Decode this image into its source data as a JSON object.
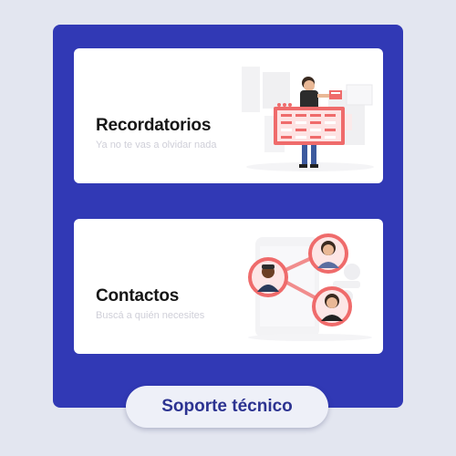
{
  "cards": [
    {
      "title": "Recordatorios",
      "subtitle": "Ya no te vas a olvidar nada",
      "icon": "calendar-reminder-illustration-icon"
    },
    {
      "title": "Contactos",
      "subtitle": "Buscá a quién necesites",
      "icon": "contacts-network-illustration-icon"
    }
  ],
  "support_button": {
    "label": "Soporte técnico"
  },
  "colors": {
    "background": "#e3e6f0",
    "panel": "#3139b5",
    "card": "#ffffff",
    "accent_red": "#ef6b6b",
    "button_text": "#2c3391"
  }
}
